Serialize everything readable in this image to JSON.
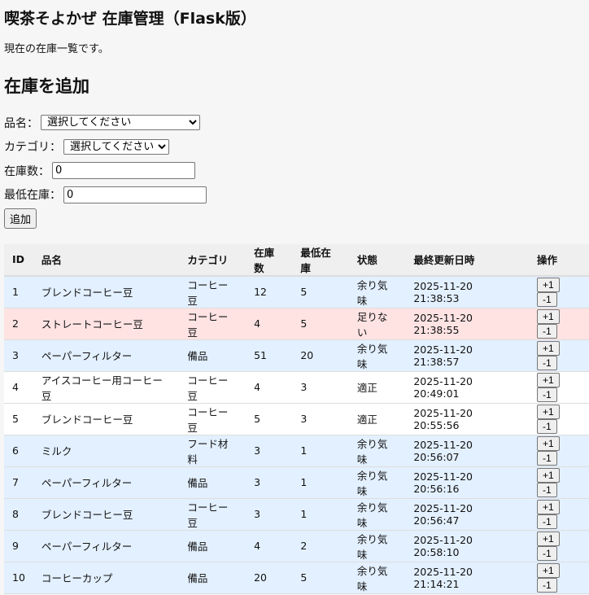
{
  "title": "喫茶そよかぜ 在庫管理（Flask版）",
  "intro": "現在の在庫一覧です。",
  "form": {
    "heading": "在庫を追加",
    "name_label": "品名：",
    "name_value": "選択してください",
    "category_label": "カテゴリ：",
    "category_value": "選択してください",
    "stock_label": "在庫数：",
    "stock_value": "0",
    "min_label": "最低在庫：",
    "min_value": "0",
    "submit": "追加"
  },
  "table": {
    "headers": [
      "ID",
      "品名",
      "カテゴリ",
      "在庫数",
      "最低在庫",
      "状態",
      "最終更新日時",
      "操作"
    ],
    "plus": "+1",
    "minus": "-1",
    "rows": [
      [
        "1",
        "ブレンドコーヒー豆",
        "コーヒー豆",
        "12",
        "5",
        "余り気味",
        "2025-11-20 21:38:53"
      ],
      [
        "2",
        "ストレートコーヒー豆",
        "コーヒー豆",
        "4",
        "5",
        "足りない",
        "2025-11-20 21:38:55"
      ],
      [
        "3",
        "ペーパーフィルター",
        "備品",
        "51",
        "20",
        "余り気味",
        "2025-11-20 21:38:57"
      ],
      [
        "4",
        "アイスコーヒー用コーヒー豆",
        "コーヒー豆",
        "4",
        "3",
        "適正",
        "2025-11-20 20:49:01"
      ],
      [
        "5",
        "ブレンドコーヒー豆",
        "コーヒー豆",
        "5",
        "3",
        "適正",
        "2025-11-20 20:55:56"
      ],
      [
        "6",
        "ミルク",
        "フード材料",
        "3",
        "1",
        "余り気味",
        "2025-11-20 20:56:07"
      ],
      [
        "7",
        "ペーパーフィルター",
        "備品",
        "3",
        "1",
        "余り気味",
        "2025-11-20 20:56:16"
      ],
      [
        "8",
        "ブレンドコーヒー豆",
        "コーヒー豆",
        "3",
        "1",
        "余り気味",
        "2025-11-20 20:56:47"
      ],
      [
        "9",
        "ペーパーフィルター",
        "備品",
        "4",
        "2",
        "余り気味",
        "2025-11-20 20:58:10"
      ],
      [
        "10",
        "コーヒーカップ",
        "備品",
        "20",
        "5",
        "余り気味",
        "2025-11-20 21:14:21"
      ]
    ]
  },
  "colors": {
    "over": "#e3f0ff",
    "low": "#ffe3e3",
    "ok": "#ffffff"
  }
}
